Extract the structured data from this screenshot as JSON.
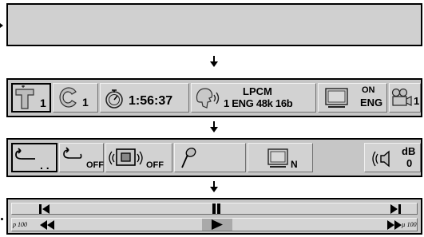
{
  "top_panel": {},
  "info_bar": {
    "title_number": "1",
    "chapter_number": "1",
    "time": "1:56:37",
    "audio_format": "LPCM",
    "audio_details": "1 ENG 48k 16b",
    "subtitle_state": "ON",
    "subtitle_language": "ENG",
    "angle_number": "1"
  },
  "settings_bar": {
    "repeat_ab_state": ". .",
    "repeat_state": "OFF",
    "surround_state": "OFF",
    "picture_mode": "N",
    "volume_unit": "dB",
    "volume_value": "0"
  },
  "playback_bar": {
    "slow_reverse_label": "p 100",
    "slow_forward_label": "µ 100"
  },
  "icons": [
    "title-icon",
    "chapter-icon",
    "clock-icon",
    "audio-icon",
    "tv-subtitle-icon",
    "camera-angle-icon",
    "repeat-ab-icon",
    "repeat-icon",
    "surround-icon",
    "marker-icon",
    "picture-tv-icon",
    "speaker-icon",
    "step-back-icon",
    "pause-icon",
    "step-forward-icon",
    "fast-reverse-icon",
    "play-icon",
    "fast-forward-icon",
    "down-arrow-icon"
  ]
}
